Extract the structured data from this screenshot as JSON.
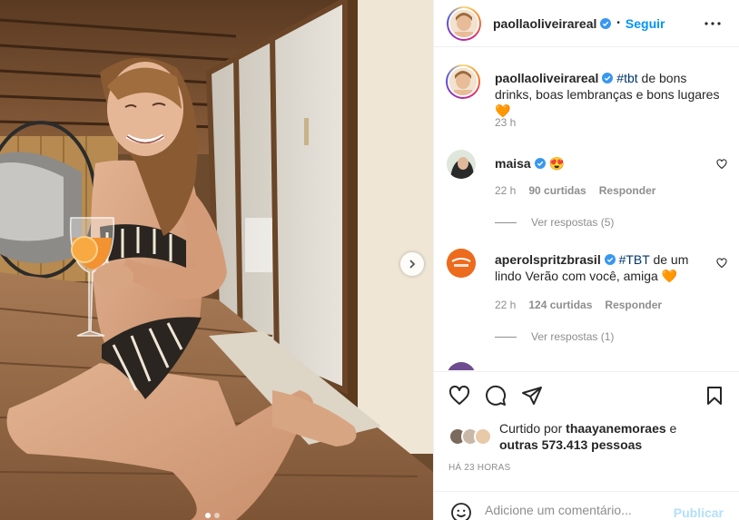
{
  "post": {
    "username": "paollaoliveirareal",
    "separator": "•",
    "follow_label": "Seguir",
    "caption_tag": "#tbt",
    "caption_text": " de bons drinks, boas lembranças e bons lugares",
    "caption_emoji": "🧡",
    "caption_time": "23 h",
    "carousel_count": 2,
    "carousel_active": 0
  },
  "comments": [
    {
      "username": "maisa",
      "text": "😍",
      "time": "22 h",
      "likes": "90 curtidas",
      "reply_label": "Responder",
      "view_replies": "Ver respostas (5)"
    },
    {
      "username": "aperolspritzbrasil",
      "tag": "#TBT",
      "text": " de um lindo Verão com você, amiga",
      "emoji": "🧡",
      "time": "22 h",
      "likes": "124 curtidas",
      "reply_label": "Responder",
      "view_replies": "Ver respostas (1)"
    }
  ],
  "likes_summary": {
    "prefix": "Curtido por ",
    "user": "thaayanemoraes",
    "connector": " e",
    "others": "outras 573.413 pessoas"
  },
  "timestamp": "HÁ 23 HORAS",
  "composer": {
    "placeholder": "Adicione um comentário...",
    "publish_label": "Publicar"
  },
  "icons": {
    "verified": "verified-badge-icon",
    "more": "more-options-icon",
    "like": "heart-icon",
    "comment": "comment-icon",
    "share": "share-icon",
    "save": "bookmark-icon",
    "emoji": "emoji-icon",
    "next": "chevron-right-icon"
  },
  "colors": {
    "accent_blue": "#0095f6",
    "publish_disabled": "#b2dffc",
    "secondary_text": "#8e8e8e",
    "tag_link": "#00376b",
    "heart_orange": "#f4812d",
    "aperol_orange": "#ec6b1d"
  }
}
